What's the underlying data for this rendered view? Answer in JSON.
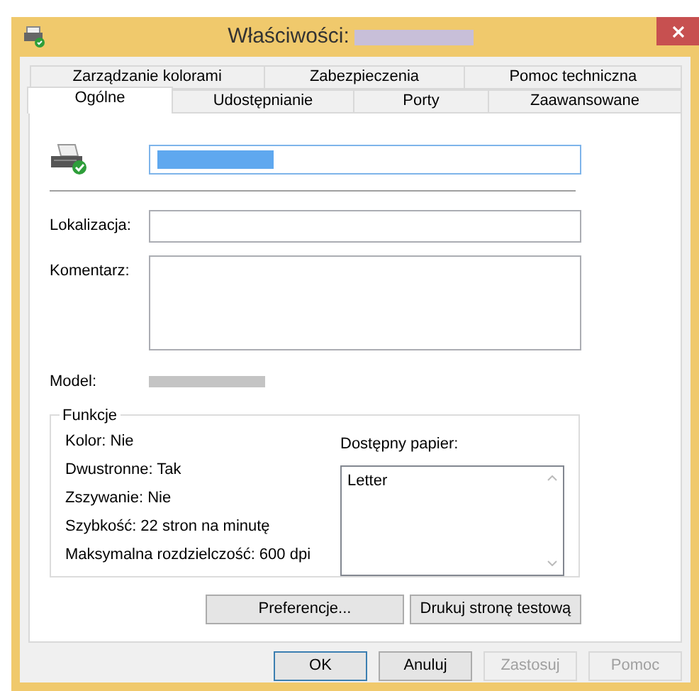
{
  "window": {
    "title": "Właściwości:",
    "title_redacted": true
  },
  "tabs": [
    [
      {
        "label": "Zarządzanie kolorami",
        "selected": false
      },
      {
        "label": "Zabezpieczenia",
        "selected": false
      },
      {
        "label": "Pomoc techniczna",
        "selected": false
      }
    ],
    [
      {
        "label": "Ogólne",
        "selected": true
      },
      {
        "label": "Udostępnianie",
        "selected": false
      },
      {
        "label": "Porty",
        "selected": false
      },
      {
        "label": "Zaawansowane",
        "selected": false
      }
    ]
  ],
  "general": {
    "printer_name_redacted": true,
    "location": {
      "label": "Lokalizacja:"
    },
    "comment": {
      "label": "Komentarz:"
    },
    "model": {
      "label": "Model:",
      "value_redacted": true
    },
    "features": {
      "title": "Funkcje",
      "items": [
        "Kolor: Nie",
        "Dwustronne: Tak",
        "Zszywanie: Nie",
        "Szybkość: 22 stron na minutę",
        "Maksymalna rozdzielczość: 600  dpi"
      ],
      "paper_label": "Dostępny papier:",
      "paper": [
        "Letter"
      ]
    },
    "buttons": [
      "Preferencje...",
      "Drukuj stronę testową"
    ]
  },
  "buttons": [
    {
      "label": "OK",
      "default": true,
      "disabled": false
    },
    {
      "label": "Anuluj",
      "default": false,
      "disabled": false
    },
    {
      "label": "Zastosuj",
      "default": false,
      "disabled": true
    },
    {
      "label": "Pomoc",
      "default": false,
      "disabled": true
    }
  ]
}
